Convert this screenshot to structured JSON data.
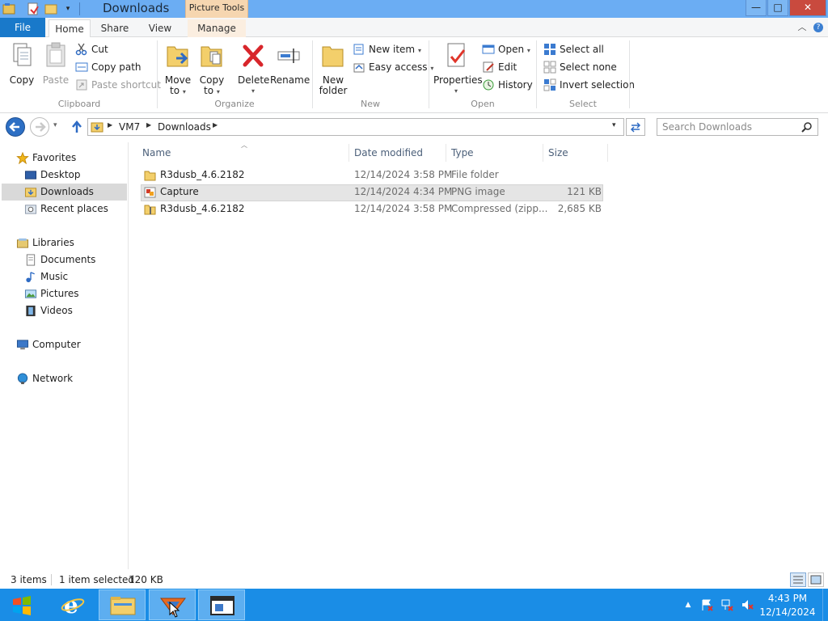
{
  "window": {
    "title": "Downloads",
    "contextual_tab": "Picture Tools",
    "controls": {
      "minimize": "—",
      "maximize": "□",
      "close": "✕"
    }
  },
  "ribbon_tabs": [
    "File",
    "Home",
    "Share",
    "View",
    "Manage"
  ],
  "ribbon": {
    "clipboard": {
      "label": "Clipboard",
      "copy": "Copy",
      "paste": "Paste",
      "cut": "Cut",
      "copy_path": "Copy path",
      "paste_shortcut": "Paste shortcut"
    },
    "organize": {
      "label": "Organize",
      "move_to": [
        "Move",
        "to"
      ],
      "copy_to": [
        "Copy",
        "to"
      ],
      "delete": "Delete",
      "rename": "Rename"
    },
    "new": {
      "label": "New",
      "new_folder": [
        "New",
        "folder"
      ],
      "new_item": "New item",
      "easy_access": "Easy access"
    },
    "open": {
      "label": "Open",
      "properties": "Properties",
      "open": "Open",
      "edit": "Edit",
      "history": "History"
    },
    "select": {
      "label": "Select",
      "select_all": "Select all",
      "select_none": "Select none",
      "invert_selection": "Invert selection"
    }
  },
  "address": {
    "crumbs": [
      "VM7",
      "Downloads"
    ],
    "search_placeholder": "Search Downloads"
  },
  "nav": {
    "favorites": "Favorites",
    "desktop": "Desktop",
    "downloads": "Downloads",
    "recent_places": "Recent places",
    "libraries": "Libraries",
    "documents": "Documents",
    "music": "Music",
    "pictures": "Pictures",
    "videos": "Videos",
    "computer": "Computer",
    "network": "Network"
  },
  "columns": [
    "Name",
    "Date modified",
    "Type",
    "Size"
  ],
  "files": [
    {
      "name": "R3dusb_4.6.2182",
      "date": "12/14/2024 3:58 PM",
      "type": "File folder",
      "size": "",
      "icon": "folder-icon"
    },
    {
      "name": "Capture",
      "date": "12/14/2024 4:34 PM",
      "type": "PNG image",
      "size": "121 KB",
      "icon": "png-image-icon"
    },
    {
      "name": "R3dusb_4.6.2182",
      "date": "12/14/2024 3:58 PM",
      "type": "Compressed (zipp...",
      "size": "2,685 KB",
      "icon": "zip-folder-icon"
    }
  ],
  "status": {
    "items": "3 items",
    "selected": "1 item selected",
    "size": "120 KB"
  },
  "taskbar": {
    "time": "4:43 PM",
    "date": "12/14/2024"
  },
  "colors": {
    "titlebar": "#6badf3",
    "file_tab": "#1979ca",
    "taskbar": "#1a8de6",
    "selection": "#e5e5e5"
  }
}
